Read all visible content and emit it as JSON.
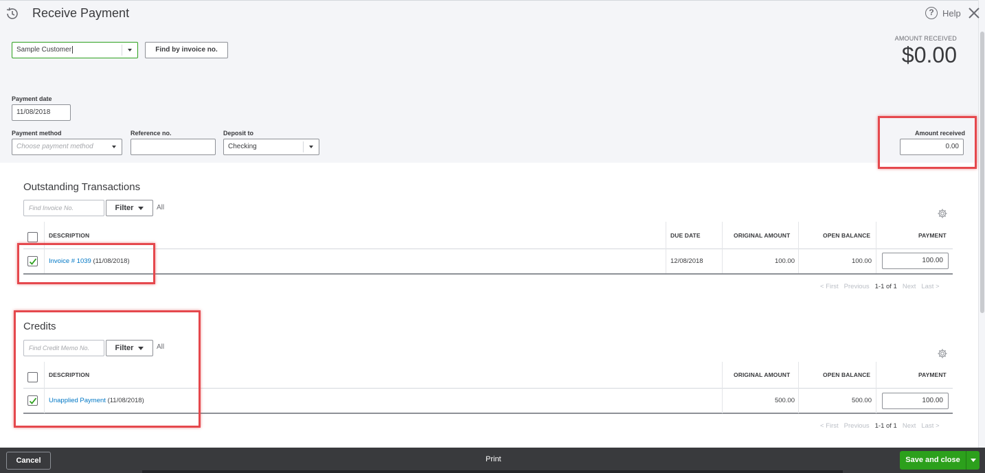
{
  "header": {
    "title": "Receive Payment",
    "help_label": "Help",
    "amount_received_label": "AMOUNT RECEIVED",
    "amount_received_value": "$0.00"
  },
  "customer": {
    "value": "Sample Customer",
    "find_button": "Find by invoice no."
  },
  "form": {
    "payment_date_label": "Payment date",
    "payment_date_value": "11/08/2018",
    "payment_method_label": "Payment method",
    "payment_method_placeholder": "Choose payment method",
    "reference_label": "Reference no.",
    "reference_value": "",
    "deposit_label": "Deposit to",
    "deposit_value": "Checking",
    "amount_label": "Amount received",
    "amount_value": "0.00"
  },
  "outstanding": {
    "title": "Outstanding Transactions",
    "search_placeholder": "Find Invoice No.",
    "filter_label": "Filter",
    "all_label": "All",
    "columns": [
      "DESCRIPTION",
      "DUE DATE",
      "ORIGINAL AMOUNT",
      "OPEN BALANCE",
      "PAYMENT"
    ],
    "rows": [
      {
        "checked": true,
        "link": "Invoice # 1039",
        "date": "(11/08/2018)",
        "due": "12/08/2018",
        "original": "100.00",
        "open": "100.00",
        "payment": "100.00"
      }
    ],
    "pager": {
      "first": "< First",
      "previous": "Previous",
      "range": "1-1 of 1",
      "next": "Next",
      "last": "Last >"
    }
  },
  "credits": {
    "title": "Credits",
    "search_placeholder": "Find Credit Memo No.",
    "filter_label": "Filter",
    "all_label": "All",
    "columns": [
      "DESCRIPTION",
      "ORIGINAL AMOUNT",
      "OPEN BALANCE",
      "PAYMENT"
    ],
    "rows": [
      {
        "checked": true,
        "link": "Unapplied Payment",
        "date": "(11/08/2018)",
        "original": "500.00",
        "open": "500.00",
        "payment": "100.00"
      }
    ],
    "pager": {
      "first": "< First",
      "previous": "Previous",
      "range": "1-1 of 1",
      "next": "Next",
      "last": "Last >"
    }
  },
  "footer": {
    "cancel": "Cancel",
    "print": "Print",
    "save": "Save and close"
  },
  "colors": {
    "highlight": "#e5484d",
    "link": "#0077c5",
    "primary": "#2ca01c",
    "footer_bg": "#393a3d"
  }
}
